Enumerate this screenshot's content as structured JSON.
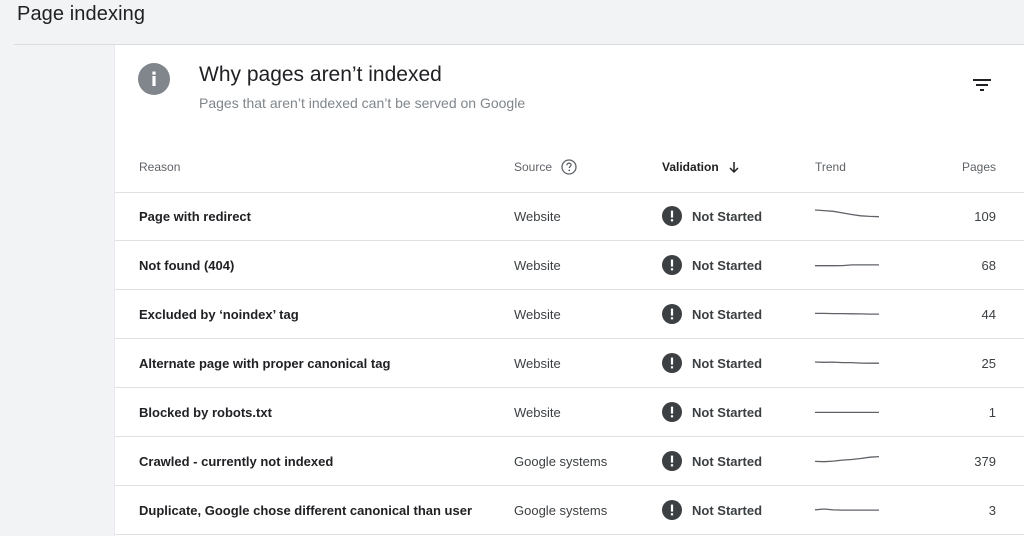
{
  "page": {
    "title": "Page indexing"
  },
  "card": {
    "title": "Why pages aren’t indexed",
    "subtitle": "Pages that aren’t indexed can’t be served on Google"
  },
  "table": {
    "headers": {
      "reason": "Reason",
      "source": "Source",
      "validation": "Validation",
      "trend": "Trend",
      "pages": "Pages"
    },
    "rows": [
      {
        "reason": "Page with redirect",
        "source": "Website",
        "validation": "Not Started",
        "pages": "109",
        "trend": [
          10,
          9.6,
          9.2,
          8.2,
          7.2,
          6.4,
          6.0,
          5.8
        ]
      },
      {
        "reason": "Not found (404)",
        "source": "Website",
        "validation": "Not Started",
        "pages": "68",
        "trend": [
          5.8,
          5.8,
          5.8,
          5.9,
          6.3,
          6.3,
          6.3,
          6.3
        ]
      },
      {
        "reason": "Excluded by ‘noindex’ tag",
        "source": "Website",
        "validation": "Not Started",
        "pages": "44",
        "trend": [
          6.6,
          6.6,
          6.5,
          6.5,
          6.4,
          6.3,
          6.2,
          6.2
        ]
      },
      {
        "reason": "Alternate page with proper canonical tag",
        "source": "Website",
        "validation": "Not Started",
        "pages": "25",
        "trend": [
          6.9,
          6.7,
          6.8,
          6.5,
          6.5,
          6.2,
          6.1,
          6.1
        ]
      },
      {
        "reason": "Blocked by robots.txt",
        "source": "Website",
        "validation": "Not Started",
        "pages": "1",
        "trend": [
          6.0,
          6.0,
          6.0,
          6.0,
          6.0,
          6.0,
          6.0,
          6.0
        ]
      },
      {
        "reason": "Crawled - currently not indexed",
        "source": "Google systems",
        "validation": "Not Started",
        "pages": "379",
        "trend": [
          6.0,
          5.8,
          6.2,
          6.8,
          7.2,
          7.8,
          8.6,
          9.0
        ]
      },
      {
        "reason": "Duplicate, Google chose different canonical than user",
        "source": "Google systems",
        "validation": "Not Started",
        "pages": "3",
        "trend": [
          6.4,
          6.9,
          6.3,
          6.2,
          6.2,
          6.2,
          6.2,
          6.2
        ]
      }
    ]
  },
  "colors": {
    "background": "#f1f3f4",
    "card": "#ffffff",
    "text_primary": "#202124",
    "text_secondary": "#5f6368",
    "status_icon": "#3c4043",
    "sparkline": "#5f6368",
    "divider": "#e0e0e0"
  },
  "icons": {
    "info": "info-icon",
    "filter": "filter-icon",
    "help": "help-circle-icon",
    "sort": "arrow-down-icon",
    "status": "exclamation-circle-icon"
  }
}
